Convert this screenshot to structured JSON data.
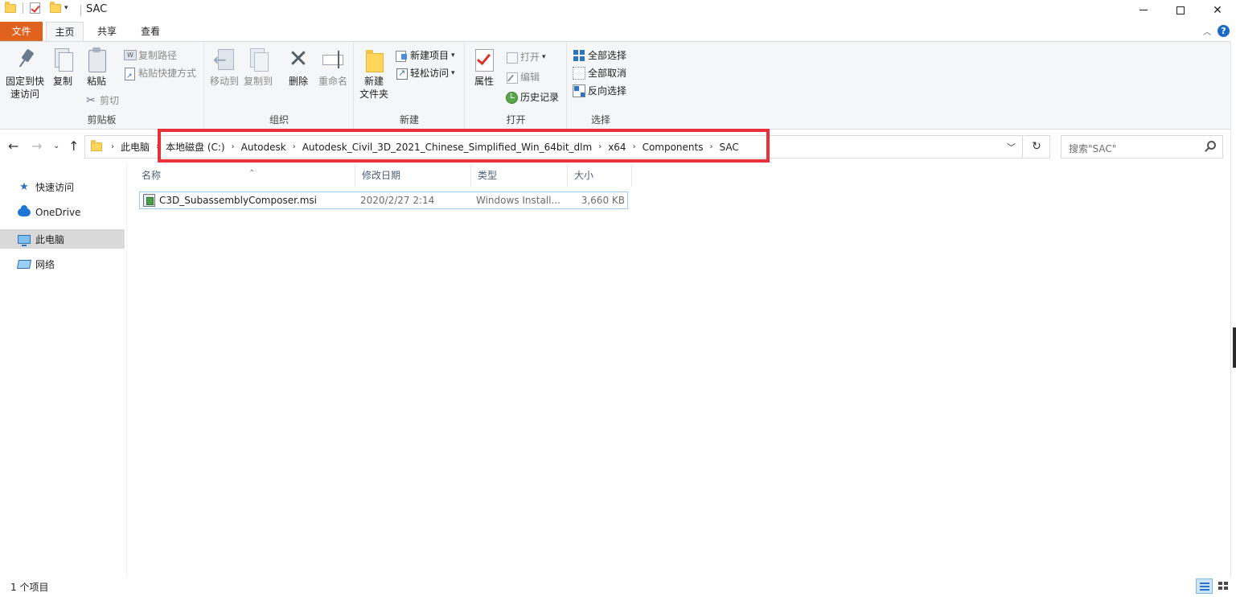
{
  "window": {
    "title": "SAC"
  },
  "tabs": {
    "file": "文件",
    "home": "主页",
    "share": "共享",
    "view": "查看"
  },
  "ribbon": {
    "clipboard": {
      "label": "剪贴板",
      "pin_line1": "固定到快",
      "pin_line2": "速访问",
      "copy": "复制",
      "paste": "粘贴",
      "copy_path": "复制路径",
      "paste_shortcut": "粘贴快捷方式",
      "cut": "剪切"
    },
    "organize": {
      "label": "组织",
      "move_to": "移动到",
      "copy_to": "复制到",
      "delete": "删除",
      "rename": "重命名"
    },
    "new": {
      "label": "新建",
      "new_folder_line1": "新建",
      "new_folder_line2": "文件夹",
      "new_item": "新建项目",
      "easy_access": "轻松访问"
    },
    "open": {
      "label": "打开",
      "properties": "属性",
      "open": "打开",
      "edit": "编辑",
      "history": "历史记录"
    },
    "select": {
      "label": "选择",
      "select_all": "全部选择",
      "select_none": "全部取消",
      "invert": "反向选择"
    }
  },
  "address": {
    "crumbs": [
      "此电脑",
      "本地磁盘 (C:)",
      "Autodesk",
      "Autodesk_Civil_3D_2021_Chinese_Simplified_Win_64bit_dlm",
      "x64",
      "Components",
      "SAC"
    ]
  },
  "search": {
    "placeholder": "搜索\"SAC\""
  },
  "navpane": {
    "items": [
      "快速访问",
      "OneDrive",
      "此电脑",
      "网络"
    ],
    "selected": "此电脑"
  },
  "filelist": {
    "columns": [
      "名称",
      "修改日期",
      "类型",
      "大小"
    ],
    "rows": [
      {
        "name": "C3D_SubassemblyComposer.msi",
        "modified": "2020/2/27 2:14",
        "type": "Windows Install...",
        "size": "3,660 KB"
      }
    ]
  },
  "status": {
    "count": "1 个项目"
  },
  "colors": {
    "file_tab": "#e1621f",
    "highlight": "#e8313a",
    "accent": "#2d73c4"
  }
}
